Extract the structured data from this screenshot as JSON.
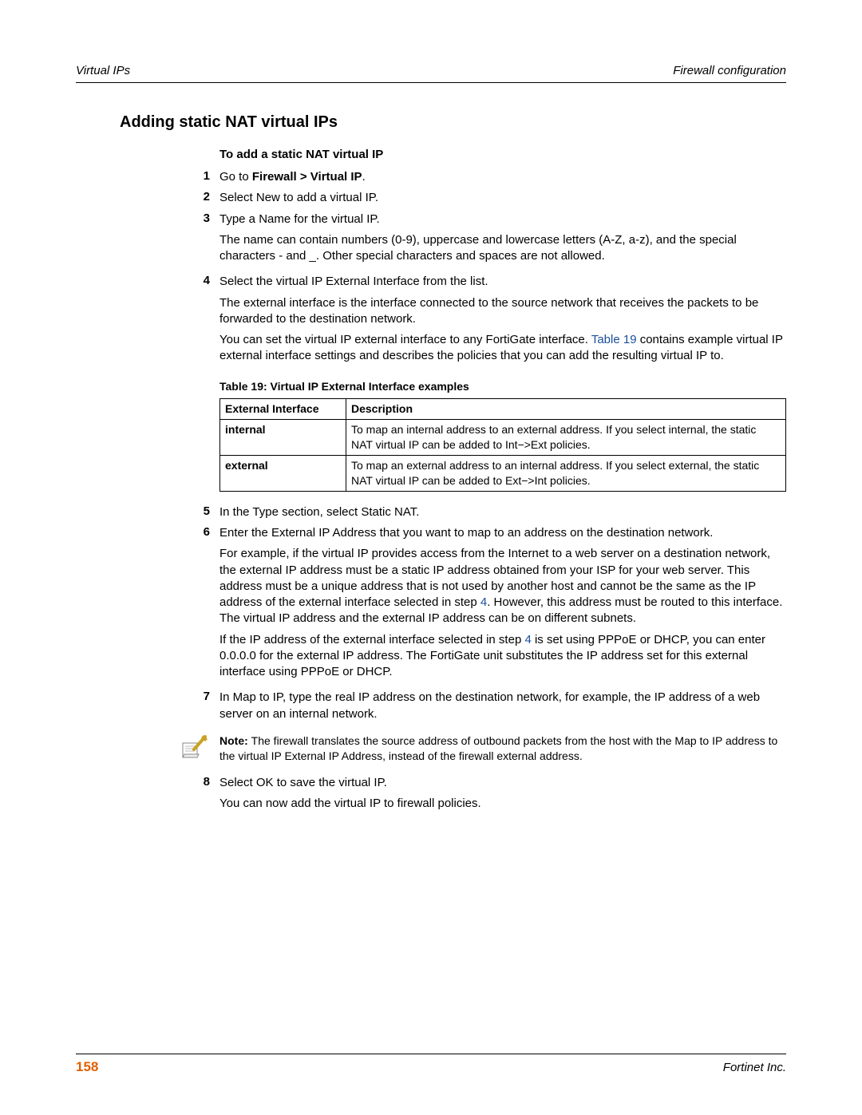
{
  "header": {
    "left": "Virtual IPs",
    "right": "Firewall configuration"
  },
  "section_title": "Adding static NAT virtual IPs",
  "subheading": "To add a static NAT virtual IP",
  "steps": {
    "s1": {
      "num": "1",
      "prefix": "Go to ",
      "bold": "Firewall > Virtual IP",
      "suffix": "."
    },
    "s2": {
      "num": "2",
      "text": "Select New to add a virtual IP."
    },
    "s3": {
      "num": "3",
      "p1": "Type a Name for the virtual IP.",
      "p2": "The name can contain numbers (0-9), uppercase and lowercase letters (A-Z, a-z), and the special characters - and _. Other special characters and spaces are not allowed."
    },
    "s4": {
      "num": "4",
      "p1": "Select the virtual IP External Interface from the list.",
      "p2": "The external interface is the interface connected to the source network that receives the packets to be forwarded to the destination network.",
      "p3a": "You can set the virtual IP external interface to any FortiGate interface. ",
      "p3link": "Table 19",
      "p3b": " contains example virtual IP external interface settings and describes the policies that you can add the resulting virtual IP to."
    },
    "s5": {
      "num": "5",
      "text": "In the Type section, select Static NAT."
    },
    "s6": {
      "num": "6",
      "p1": "Enter the External IP Address that you want to map to an address on the destination network.",
      "p2a": "For example, if the virtual IP provides access from the Internet to a web server on a destination network, the external IP address must be a static IP address obtained from your ISP for your web server. This address must be a unique address that is not used by another host and cannot be the same as the IP address of the external interface selected in step ",
      "p2link": "4",
      "p2b": ". However, this address must be routed to this interface. The virtual IP address and the external IP address can be on different subnets.",
      "p3a": "If the IP address of the external interface selected in step ",
      "p3link": "4",
      "p3b": " is set using PPPoE or DHCP, you can enter 0.0.0.0 for the external IP address. The FortiGate unit substitutes the IP address set for this external interface using PPPoE or DHCP."
    },
    "s7": {
      "num": "7",
      "text": "In Map to IP, type the real IP address on the destination network, for example, the IP address of a web server on an internal network."
    },
    "s8": {
      "num": "8",
      "p1": "Select OK to save the virtual IP.",
      "p2": "You can now add the virtual IP to firewall policies."
    }
  },
  "table": {
    "caption": "Table 19: Virtual IP External Interface examples",
    "headers": {
      "c1": "External Interface",
      "c2": "Description"
    },
    "rows": [
      {
        "c1": "internal",
        "c2": "To map an internal address to an external address. If you select internal, the static NAT virtual IP can be added to Int−>Ext policies."
      },
      {
        "c1": "external",
        "c2": "To map an external address to an internal address. If you select external, the static NAT virtual IP can be added to Ext−>Int policies."
      }
    ]
  },
  "note": {
    "bold": "Note: ",
    "text": "The firewall translates the source address of outbound packets from the host with the Map to IP address to the virtual IP External IP Address, instead of the firewall external address."
  },
  "footer": {
    "page": "158",
    "right": "Fortinet Inc."
  }
}
